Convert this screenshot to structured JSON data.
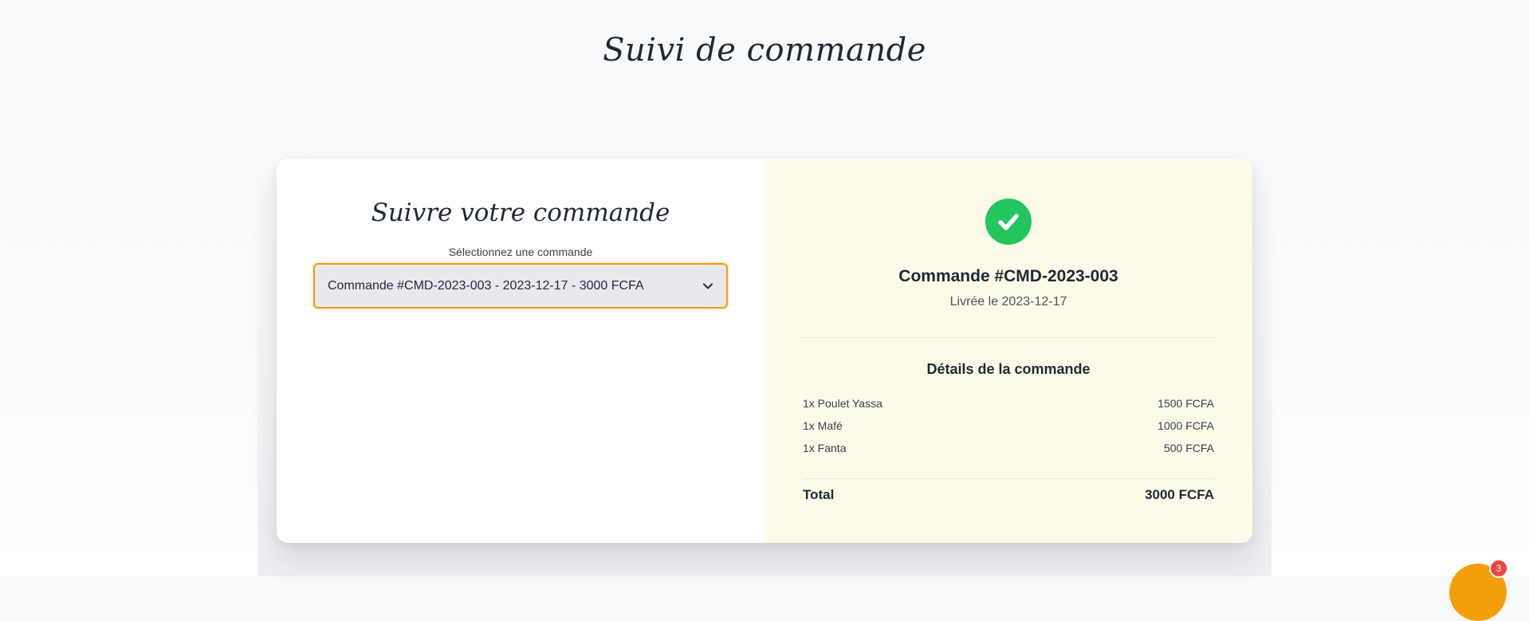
{
  "page": {
    "title": "Suivi de commande"
  },
  "tracking_form": {
    "title": "Suivre votre commande",
    "select_label": "Sélectionnez une commande",
    "selected_order": "Commande #CMD-2023-003 - 2023-12-17 - 3000 FCFA"
  },
  "order_status": {
    "icon": "check-circle-icon",
    "order_number": "Commande #CMD-2023-003",
    "delivery_text": "Livrée le 2023-12-17",
    "details_title": "Détails de la commande",
    "items": [
      {
        "name": "1x Poulet Yassa",
        "price": "1500 FCFA"
      },
      {
        "name": "1x Mafé",
        "price": "1000 FCFA"
      },
      {
        "name": "1x Fanta",
        "price": "500 FCFA"
      }
    ],
    "total_label": "Total",
    "total_value": "3000 FCFA"
  },
  "chat_widget": {
    "notification_count": "3"
  },
  "colors": {
    "accent": "#f59e0b",
    "success": "#22c55e",
    "badge": "#ef4444",
    "right_panel_bg": "#fefae8",
    "select_bg": "#e9e9ed"
  }
}
